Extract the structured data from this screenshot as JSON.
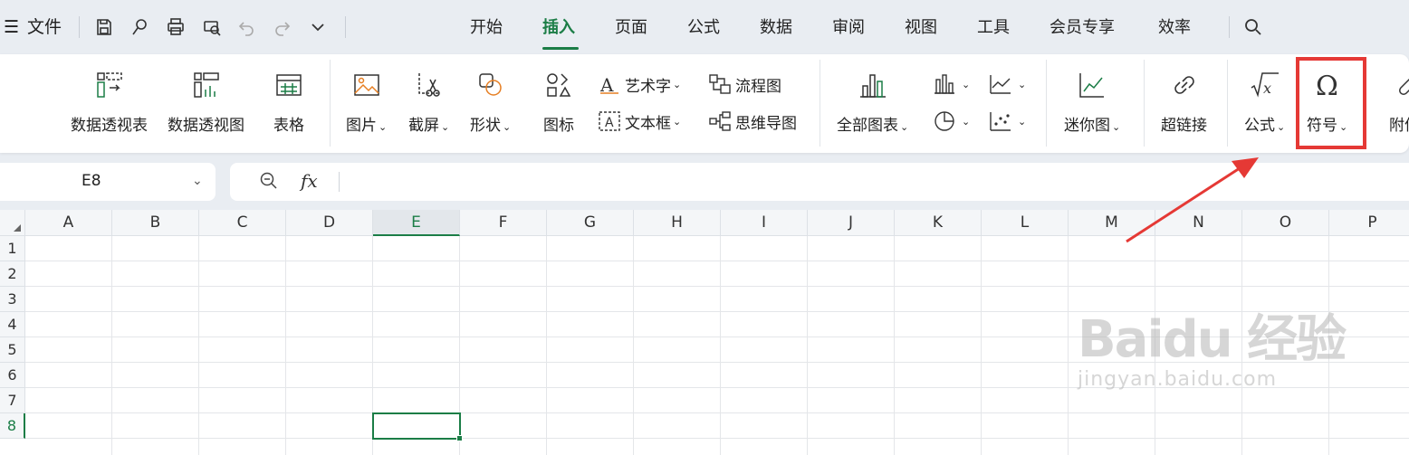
{
  "menu": {
    "file_label": "文件",
    "tabs": [
      "开始",
      "插入",
      "页面",
      "公式",
      "数据",
      "审阅",
      "视图",
      "工具",
      "会员专享",
      "效率"
    ],
    "active_tab": "插入"
  },
  "ribbon": {
    "pivot_table": "数据透视表",
    "pivot_chart": "数据透视图",
    "table": "表格",
    "picture": "图片",
    "screenshot": "截屏",
    "shape": "形状",
    "icon": "图标",
    "wordart": "艺术字",
    "textbox": "文本框",
    "flowchart": "流程图",
    "mindmap": "思维导图",
    "all_charts": "全部图表",
    "sparkline": "迷你图",
    "hyperlink": "超链接",
    "formula": "公式",
    "symbol": "符号",
    "attachment": "附件"
  },
  "name_box": {
    "value": "E8"
  },
  "formula_bar": {
    "fx": "fx",
    "value": ""
  },
  "grid": {
    "columns": [
      "A",
      "B",
      "C",
      "D",
      "E",
      "F",
      "G",
      "H",
      "I",
      "J",
      "K",
      "L",
      "M",
      "N",
      "O",
      "P"
    ],
    "rows": [
      "1",
      "2",
      "3",
      "4",
      "5",
      "6",
      "7",
      "8"
    ],
    "selected_cell": "E8",
    "selected_column": "E",
    "selected_row": "8"
  },
  "watermark": {
    "brand": "Baidu 经验",
    "url": "jingyan.baidu.com"
  },
  "colors": {
    "accent": "#1b7d46",
    "highlight": "#e53935"
  }
}
